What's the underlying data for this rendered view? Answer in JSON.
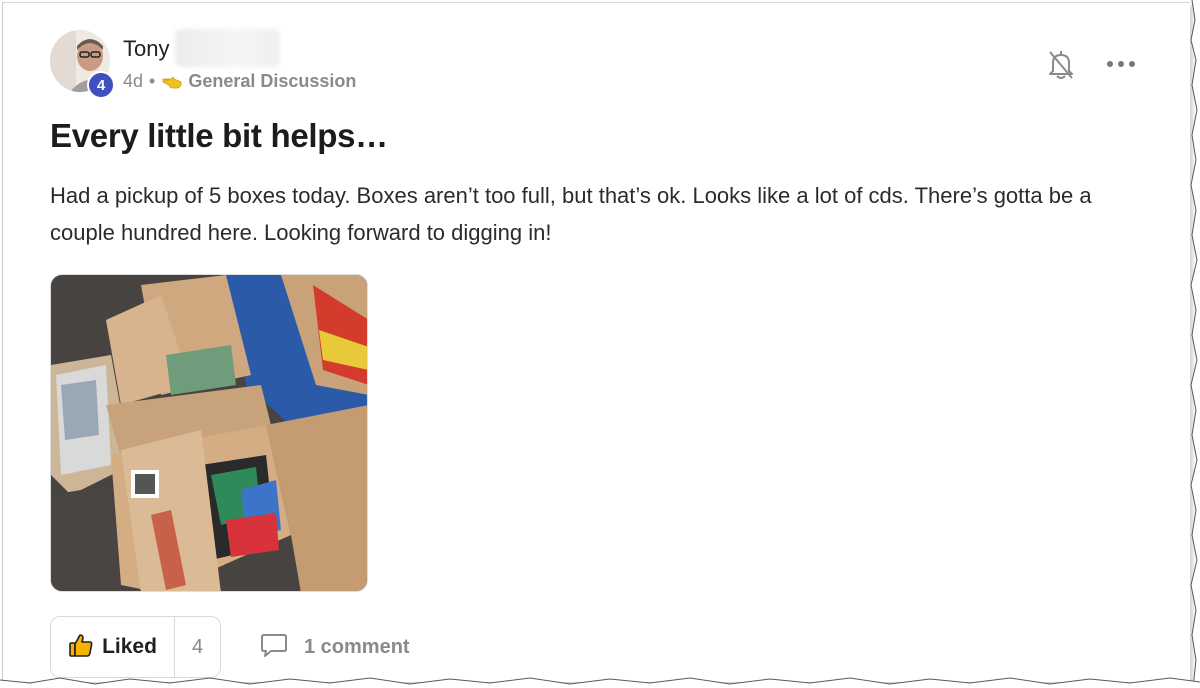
{
  "post": {
    "author": {
      "name": "Tony",
      "rank_badge": "4",
      "avatar_icon": "person-avatar"
    },
    "meta": {
      "age": "4d",
      "separator": "•",
      "category_icon": "pointing-hand-icon",
      "category": "General Discussion"
    },
    "title": "Every little bit helps…",
    "body": "Had a pickup of 5 boxes today. Boxes aren’t too full, but that’s ok. Looks like a lot of cds. There’s gotta be a couple hundred here. Looking forward to digging in!",
    "image_icon": "photo-of-boxes-with-cds",
    "actions": {
      "like_label": "Liked",
      "like_count": "4",
      "comment_label": "1 comment"
    },
    "icons": {
      "bell": "bell-off-icon",
      "more": "more-dots-icon",
      "like": "thumbs-up-icon",
      "comment": "comment-bubble-icon"
    }
  },
  "colors": {
    "badge": "#3f4fc0",
    "text": "#1f1f1f",
    "muted": "#8a8a8a",
    "border": "#d9d9d9"
  }
}
